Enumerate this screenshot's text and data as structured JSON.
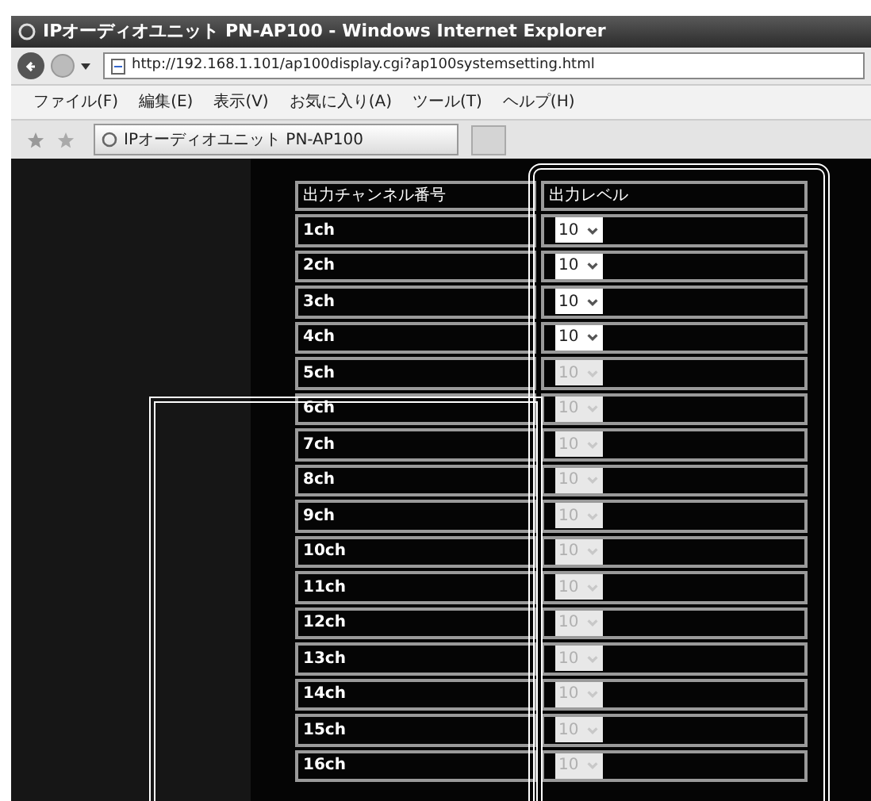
{
  "window": {
    "title": "IPオーディオユニット PN-AP100 - Windows Internet Explorer"
  },
  "address_bar": {
    "url": "http://192.168.1.101/ap100display.cgi?ap100systemsetting.html"
  },
  "menu": [
    "ファイル(F)",
    "編集(E)",
    "表示(V)",
    "お気に入り(A)",
    "ツール(T)",
    "ヘルプ(H)"
  ],
  "tab": {
    "title": "IPオーディオユニット PN-AP100"
  },
  "table": {
    "columns": [
      "出力チャンネル番号",
      "出力レベル"
    ],
    "rows": [
      {
        "channel": "1ch",
        "level": "10",
        "disabled": false
      },
      {
        "channel": "2ch",
        "level": "10",
        "disabled": false
      },
      {
        "channel": "3ch",
        "level": "10",
        "disabled": false
      },
      {
        "channel": "4ch",
        "level": "10",
        "disabled": false
      },
      {
        "channel": "5ch",
        "level": "10",
        "disabled": true
      },
      {
        "channel": "6ch",
        "level": "10",
        "disabled": true
      },
      {
        "channel": "7ch",
        "level": "10",
        "disabled": true
      },
      {
        "channel": "8ch",
        "level": "10",
        "disabled": true
      },
      {
        "channel": "9ch",
        "level": "10",
        "disabled": true
      },
      {
        "channel": "10ch",
        "level": "10",
        "disabled": true
      },
      {
        "channel": "11ch",
        "level": "10",
        "disabled": true
      },
      {
        "channel": "12ch",
        "level": "10",
        "disabled": true
      },
      {
        "channel": "13ch",
        "level": "10",
        "disabled": true
      },
      {
        "channel": "14ch",
        "level": "10",
        "disabled": true
      },
      {
        "channel": "15ch",
        "level": "10",
        "disabled": true
      },
      {
        "channel": "16ch",
        "level": "10",
        "disabled": true
      }
    ]
  }
}
